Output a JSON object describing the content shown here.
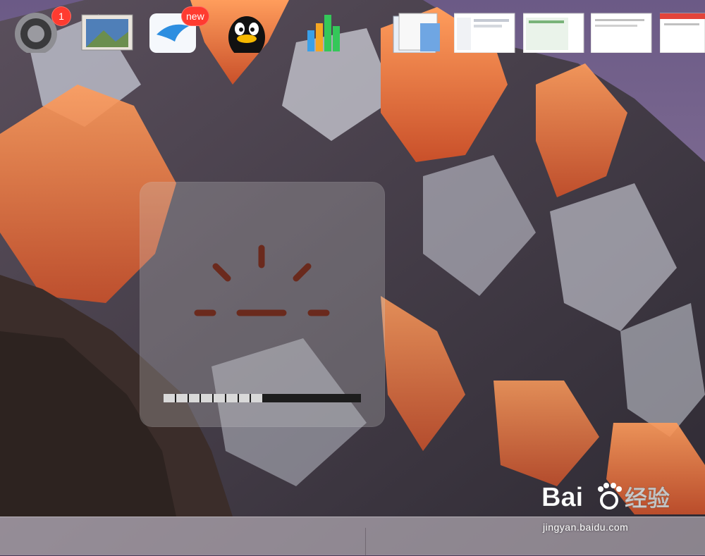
{
  "hud": {
    "icon": "keyboard-backlight-icon",
    "level_fraction": 0.5,
    "segments_total": 16,
    "segments_lit": 8
  },
  "dock": {
    "items": [
      {
        "name": "system-preferences",
        "icon": "gear-icon",
        "badge": "1"
      },
      {
        "name": "preview",
        "icon": "photo-icon",
        "badge": ""
      },
      {
        "name": "mail-app",
        "icon": "bird-icon",
        "badge": "new"
      },
      {
        "name": "qq",
        "icon": "penguin-icon",
        "badge": ""
      },
      {
        "name": "numbers",
        "icon": "bar-chart-icon",
        "badge": ""
      },
      {
        "name": "documents-stack",
        "icon": "document-icon",
        "badge": ""
      },
      {
        "name": "window-thumbnail-1",
        "icon": "window-thumbnail-icon",
        "badge": ""
      },
      {
        "name": "window-thumbnail-2",
        "icon": "window-thumbnail-icon",
        "badge": ""
      },
      {
        "name": "window-thumbnail-3",
        "icon": "window-thumbnail-icon",
        "badge": ""
      },
      {
        "name": "window-thumbnail-4",
        "icon": "window-thumbnail-icon",
        "badge": ""
      }
    ]
  },
  "watermark": {
    "brand": "Bai",
    "brand_cn": "经验",
    "url": "jingyan.baidu.com"
  },
  "colors": {
    "badge_red": "#ff3b30",
    "hud_glyph": "#6b2010",
    "level_lit": "#d9d9d9",
    "level_track": "#1d1d1d"
  }
}
